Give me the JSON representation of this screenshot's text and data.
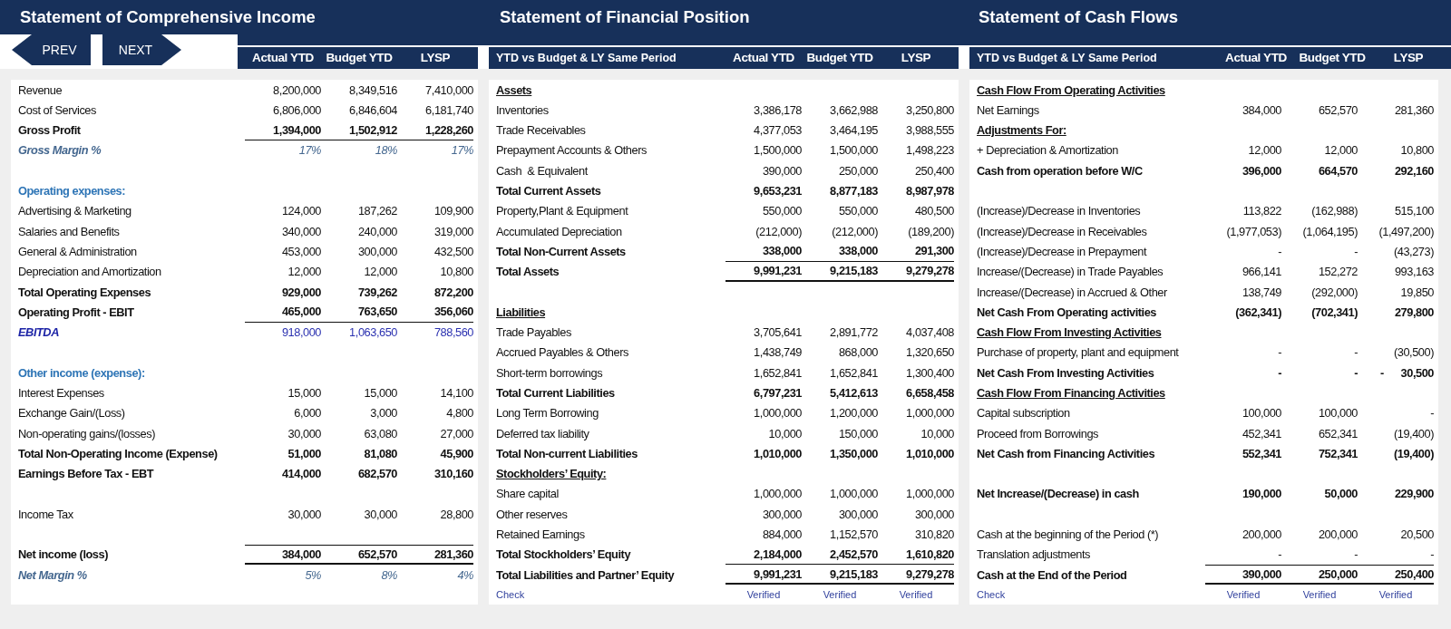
{
  "navigation": [
    {
      "kind": "prev",
      "label": "PREV"
    },
    {
      "kind": "next",
      "label": "NEXT"
    }
  ],
  "panels": [
    {
      "title": "Statement of Comprehensive Income",
      "column_headers": [
        "Actual YTD",
        "Budget YTD",
        "LYSP"
      ],
      "rows": [
        {
          "kind": "item",
          "label": "Revenue",
          "values": [
            "8,200,000",
            "8,349,516",
            "7,410,000"
          ]
        },
        {
          "kind": "item",
          "label": "Cost of Services",
          "values": [
            "6,806,000",
            "6,846,604",
            "6,181,740"
          ]
        },
        {
          "kind": "total",
          "label": "Gross Profit",
          "values": [
            "1,394,000",
            "1,502,912",
            "1,228,260"
          ],
          "rule_below": true
        },
        {
          "kind": "ratio",
          "label": "Gross Margin %",
          "values": [
            "17%",
            "18%",
            "17%"
          ]
        },
        {
          "kind": "blank"
        },
        {
          "kind": "section",
          "label": "Operating expenses:"
        },
        {
          "kind": "item",
          "label": "Advertising & Marketing",
          "values": [
            "124,000",
            "187,262",
            "109,900"
          ]
        },
        {
          "kind": "item",
          "label": "Salaries and Benefits",
          "values": [
            "340,000",
            "240,000",
            "319,000"
          ]
        },
        {
          "kind": "item",
          "label": "General & Administration",
          "values": [
            "453,000",
            "300,000",
            "432,500"
          ]
        },
        {
          "kind": "item",
          "label": "Depreciation and Amortization",
          "values": [
            "12,000",
            "12,000",
            "10,800"
          ]
        },
        {
          "kind": "total",
          "label": "Total Operating Expenses",
          "values": [
            "929,000",
            "739,262",
            "872,200"
          ]
        },
        {
          "kind": "total",
          "label": "Operating Profit - EBIT",
          "values": [
            "465,000",
            "763,650",
            "356,060"
          ],
          "rule_below": true
        },
        {
          "kind": "highlight",
          "label": "EBITDA",
          "values": [
            "918,000",
            "1,063,650",
            "788,560"
          ]
        },
        {
          "kind": "blank"
        },
        {
          "kind": "section",
          "label": "Other income (expense):"
        },
        {
          "kind": "item",
          "label": "Interest Expenses",
          "values": [
            "15,000",
            "15,000",
            "14,100"
          ]
        },
        {
          "kind": "item",
          "label": "Exchange Gain/(Loss)",
          "values": [
            "6,000",
            "3,000",
            "4,800"
          ]
        },
        {
          "kind": "item",
          "label": "Non-operating gains/(losses)",
          "values": [
            "30,000",
            "63,080",
            "27,000"
          ]
        },
        {
          "kind": "total",
          "label": "Total Non-Operating Income (Expense)",
          "values": [
            "51,000",
            "81,080",
            "45,900"
          ]
        },
        {
          "kind": "total",
          "label": "Earnings Before Tax - EBT",
          "values": [
            "414,000",
            "682,570",
            "310,160"
          ]
        },
        {
          "kind": "blank"
        },
        {
          "kind": "item",
          "label": "Income Tax",
          "values": [
            "30,000",
            "30,000",
            "28,800"
          ]
        },
        {
          "kind": "blank"
        },
        {
          "kind": "total",
          "label": "Net income (loss)",
          "values": [
            "384,000",
            "652,570",
            "281,360"
          ],
          "rule_above": true,
          "heavy_rule_below": true
        },
        {
          "kind": "ratio",
          "label": "Net Margin %",
          "values": [
            "5%",
            "8%",
            "4%"
          ]
        }
      ]
    },
    {
      "title": "Statement of Financial Position",
      "period_label": "YTD vs Budget & LY Same Period",
      "column_headers": [
        "Actual YTD",
        "Budget YTD",
        "LYSP"
      ],
      "rows": [
        {
          "kind": "heading",
          "label": "Assets"
        },
        {
          "kind": "item",
          "label": "Inventories",
          "values": [
            "3,386,178",
            "3,662,988",
            "3,250,800"
          ]
        },
        {
          "kind": "item",
          "label": "Trade Receivables",
          "values": [
            "4,377,053",
            "3,464,195",
            "3,988,555"
          ]
        },
        {
          "kind": "item",
          "label": "Prepayment Accounts & Others",
          "values": [
            "1,500,000",
            "1,500,000",
            "1,498,223"
          ]
        },
        {
          "kind": "item",
          "label": "Cash  & Equivalent",
          "values": [
            "390,000",
            "250,000",
            "250,400"
          ]
        },
        {
          "kind": "total",
          "label": "Total Current Assets",
          "values": [
            "9,653,231",
            "8,877,183",
            "8,987,978"
          ]
        },
        {
          "kind": "item",
          "label": "Property,Plant & Equipment",
          "values": [
            "550,000",
            "550,000",
            "480,500"
          ]
        },
        {
          "kind": "item",
          "label": "Accumulated Depreciation",
          "values": [
            "(212,000)",
            "(212,000)",
            "(189,200)"
          ]
        },
        {
          "kind": "total",
          "label": "Total Non-Current Assets",
          "values": [
            "338,000",
            "338,000",
            "291,300"
          ],
          "rule_below": true
        },
        {
          "kind": "total",
          "label": "Total Assets",
          "values": [
            "9,991,231",
            "9,215,183",
            "9,279,278"
          ],
          "heavy_rule_below": true
        },
        {
          "kind": "blank"
        },
        {
          "kind": "heading",
          "label": "Liabilities"
        },
        {
          "kind": "item",
          "label": "Trade Payables",
          "values": [
            "3,705,641",
            "2,891,772",
            "4,037,408"
          ]
        },
        {
          "kind": "item",
          "label": "Accrued Payables & Others",
          "values": [
            "1,438,749",
            "868,000",
            "1,320,650"
          ]
        },
        {
          "kind": "item",
          "label": "Short-term borrowings",
          "values": [
            "1,652,841",
            "1,652,841",
            "1,300,400"
          ]
        },
        {
          "kind": "total",
          "label": "Total Current Liabilities",
          "values": [
            "6,797,231",
            "5,412,613",
            "6,658,458"
          ]
        },
        {
          "kind": "item",
          "label": "Long Term Borrowing",
          "values": [
            "1,000,000",
            "1,200,000",
            "1,000,000"
          ]
        },
        {
          "kind": "item",
          "label": "Deferred tax liability",
          "values": [
            "10,000",
            "150,000",
            "10,000"
          ]
        },
        {
          "kind": "total",
          "label": "Total Non-current Liabilities",
          "values": [
            "1,010,000",
            "1,350,000",
            "1,010,000"
          ]
        },
        {
          "kind": "heading",
          "label": "Stockholders’ Equity:"
        },
        {
          "kind": "item",
          "label": "Share capital",
          "values": [
            "1,000,000",
            "1,000,000",
            "1,000,000"
          ]
        },
        {
          "kind": "item",
          "label": "Other reserves",
          "values": [
            "300,000",
            "300,000",
            "300,000"
          ]
        },
        {
          "kind": "item",
          "label": "Retained Earnings",
          "values": [
            "884,000",
            "1,152,570",
            "310,820"
          ]
        },
        {
          "kind": "total",
          "label": "Total Stockholders’ Equity",
          "values": [
            "2,184,000",
            "2,452,570",
            "1,610,820"
          ],
          "rule_below": true
        },
        {
          "kind": "total",
          "label": "Total Liabilities and Partner’ Equity",
          "values": [
            "9,991,231",
            "9,215,183",
            "9,279,278"
          ],
          "heavy_rule_below": true
        },
        {
          "kind": "check",
          "label": "Check",
          "values": [
            "Verified",
            "Verified",
            "Verified"
          ]
        }
      ]
    },
    {
      "title": "Statement of Cash Flows",
      "period_label": "YTD vs Budget & LY Same Period",
      "column_headers": [
        "Actual YTD",
        "Budget YTD",
        "LYSP"
      ],
      "rows": [
        {
          "kind": "heading",
          "label": "Cash Flow From Operating Activities"
        },
        {
          "kind": "item",
          "label": "Net Earnings",
          "values": [
            "384,000",
            "652,570",
            "281,360"
          ]
        },
        {
          "kind": "heading",
          "label": "Adjustments For:"
        },
        {
          "kind": "item",
          "label": "+ Depreciation & Amortization",
          "values": [
            "12,000",
            "12,000",
            "10,800"
          ]
        },
        {
          "kind": "total",
          "label": "Cash from operation before W/C",
          "values": [
            "396,000",
            "664,570",
            "292,160"
          ]
        },
        {
          "kind": "blank"
        },
        {
          "kind": "item",
          "label": "(Increase)/Decrease in Inventories",
          "values": [
            "113,822",
            "(162,988)",
            "515,100"
          ]
        },
        {
          "kind": "item",
          "label": "(Increase)/Decrease in Receivables",
          "values": [
            "(1,977,053)",
            "(1,064,195)",
            "(1,497,200)"
          ]
        },
        {
          "kind": "item",
          "label": "(Increase)/Decrease in Prepayment",
          "values": [
            "-",
            "-",
            "(43,273)"
          ]
        },
        {
          "kind": "item",
          "label": "Increase/(Decrease) in Trade Payables",
          "values": [
            "966,141",
            "152,272",
            "993,163"
          ]
        },
        {
          "kind": "item",
          "label": "Increase/(Decrease) in Accrued & Other",
          "values": [
            "138,749",
            "(292,000)",
            "19,850"
          ]
        },
        {
          "kind": "total",
          "label": "Net Cash From Operating activities",
          "values": [
            "(362,341)",
            "(702,341)",
            "279,800"
          ]
        },
        {
          "kind": "heading",
          "label": "Cash Flow From Investing Activities"
        },
        {
          "kind": "item",
          "label": "Purchase of property, plant and equipment",
          "values": [
            "-",
            "-",
            "(30,500)"
          ]
        },
        {
          "kind": "total",
          "label": "Net Cash From Investing Activities",
          "values": [
            "-",
            "-",
            "-      30,500"
          ]
        },
        {
          "kind": "heading",
          "label": "Cash Flow From Financing Activities"
        },
        {
          "kind": "item",
          "label": "Capital subscription",
          "values": [
            "100,000",
            "100,000",
            "-"
          ]
        },
        {
          "kind": "item",
          "label": "Proceed from Borrowings",
          "values": [
            "452,341",
            "652,341",
            "(19,400)"
          ]
        },
        {
          "kind": "total",
          "label": "Net Cash from Financing Activities",
          "values": [
            "552,341",
            "752,341",
            "(19,400)"
          ]
        },
        {
          "kind": "blank"
        },
        {
          "kind": "total",
          "label": "Net Increase/(Decrease) in cash",
          "values": [
            "190,000",
            "50,000",
            "229,900"
          ]
        },
        {
          "kind": "blank"
        },
        {
          "kind": "item",
          "label": "Cash at the beginning of the Period (*)",
          "values": [
            "200,000",
            "200,000",
            "20,500"
          ]
        },
        {
          "kind": "item",
          "label": "Translation adjustments",
          "values": [
            "-",
            "-",
            "-"
          ]
        },
        {
          "kind": "total",
          "label": "Cash at the End of the Period",
          "values": [
            "390,000",
            "250,000",
            "250,400"
          ],
          "rule_above": true,
          "heavy_rule_below": true
        },
        {
          "kind": "check",
          "label": "Check",
          "values": [
            "Verified",
            "Verified",
            "Verified"
          ]
        }
      ]
    }
  ]
}
